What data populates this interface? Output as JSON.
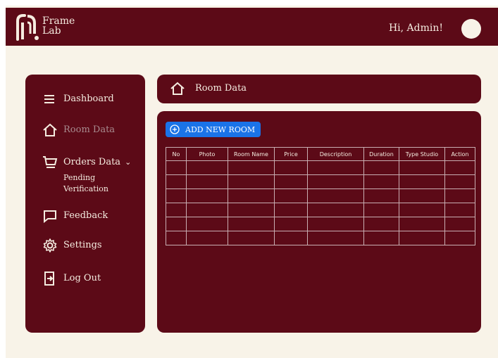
{
  "app": {
    "brand_line1": "Frame",
    "brand_line2": "Lab",
    "greeting": "Hi, Admin!"
  },
  "sidebar": {
    "items": [
      {
        "label": "Dashboard",
        "icon": "menu-icon"
      },
      {
        "label": "Room Data",
        "icon": "home-icon",
        "active": true
      },
      {
        "label": "Orders Data",
        "icon": "cart-icon",
        "has_submenu": true
      },
      {
        "label": "Feedback",
        "icon": "message-icon"
      },
      {
        "label": "Settings",
        "icon": "gear-icon"
      },
      {
        "label": "Log Out",
        "icon": "logout-icon"
      }
    ],
    "submenu_line1": "Pending",
    "submenu_line2": "Verification"
  },
  "page": {
    "title": "Room Data",
    "add_button_label": "ADD NEW ROOM"
  },
  "table": {
    "columns": [
      "No",
      "Photo",
      "Room Name",
      "Price",
      "Description",
      "Duration",
      "Type Studio",
      "Action"
    ],
    "rows": [
      [
        "",
        "",
        "",
        "",
        "",
        "",
        "",
        ""
      ],
      [
        "",
        "",
        "",
        "",
        "",
        "",
        "",
        ""
      ],
      [
        "",
        "",
        "",
        "",
        "",
        "",
        "",
        ""
      ],
      [
        "",
        "",
        "",
        "",
        "",
        "",
        "",
        ""
      ],
      [
        "",
        "",
        "",
        "",
        "",
        "",
        "",
        ""
      ],
      [
        "",
        "",
        "",
        "",
        "",
        "",
        "",
        ""
      ]
    ]
  },
  "colors": {
    "primary": "#5c0a17",
    "background": "#f8f3e8",
    "accent_button": "#1a73e8",
    "text_light": "#f5ece0"
  }
}
